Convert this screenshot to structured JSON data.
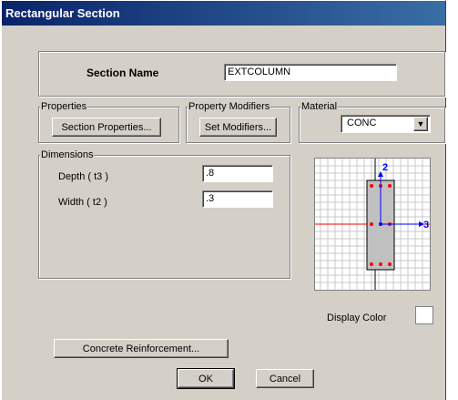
{
  "window": {
    "title": "Rectangular Section"
  },
  "section_name": {
    "label": "Section Name",
    "value": "EXTCOLUMN"
  },
  "properties": {
    "group_label": "Properties",
    "button_label": "Section Properties..."
  },
  "property_modifiers": {
    "group_label": "Property Modifiers",
    "button_label": "Set Modifiers..."
  },
  "material": {
    "group_label": "Material",
    "selected": "CONC"
  },
  "dimensions": {
    "group_label": "Dimensions",
    "depth_label": "Depth  ( t3 )",
    "depth_value": ".8",
    "width_label": "Width  ( t2 )",
    "width_value": ".3"
  },
  "preview": {
    "axis_vertical": "2",
    "axis_horizontal": "3"
  },
  "display_color": {
    "label": "Display Color"
  },
  "reinforcement_button": "Concrete Reinforcement...",
  "ok_button": "OK",
  "cancel_button": "Cancel",
  "colors": {
    "title_start": "#0a246a",
    "title_end": "#3a6ea5",
    "dialog_bg": "#d4d0c8",
    "rebar": "#ff0000",
    "axis": "#0000ff"
  }
}
